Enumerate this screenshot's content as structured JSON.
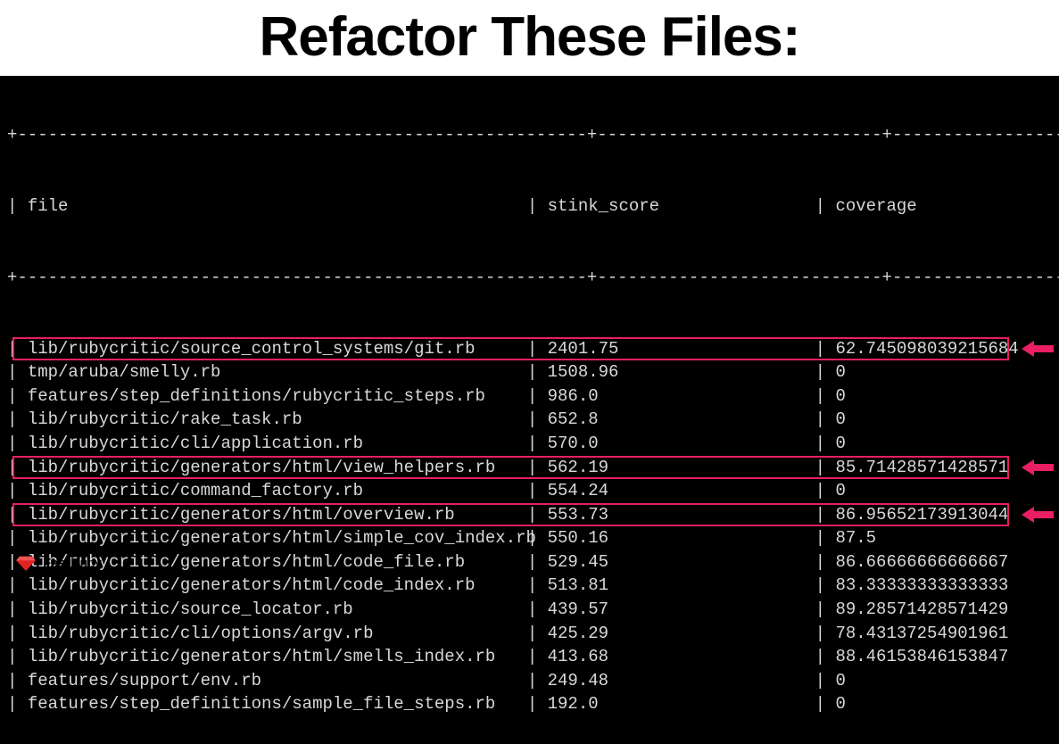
{
  "title": "Refactor These Files:",
  "footer": {
    "brand_bold": "Fast",
    "brand_rest": "Ruby"
  },
  "columns": {
    "file": "file",
    "stink": "stink_score",
    "coverage": "coverage"
  },
  "highlight_color": "#e91e63",
  "rows": [
    {
      "file": "lib/rubycritic/source_control_systems/git.rb",
      "stink": "2401.75",
      "cov": "62.745098039215684",
      "hl": true
    },
    {
      "file": "tmp/aruba/smelly.rb",
      "stink": "1508.96",
      "cov": "0",
      "hl": false
    },
    {
      "file": "features/step_definitions/rubycritic_steps.rb",
      "stink": "986.0",
      "cov": "0",
      "hl": false
    },
    {
      "file": "lib/rubycritic/rake_task.rb",
      "stink": "652.8",
      "cov": "0",
      "hl": false
    },
    {
      "file": "lib/rubycritic/cli/application.rb",
      "stink": "570.0",
      "cov": "0",
      "hl": false
    },
    {
      "file": "lib/rubycritic/generators/html/view_helpers.rb",
      "stink": "562.19",
      "cov": "85.71428571428571",
      "hl": true
    },
    {
      "file": "lib/rubycritic/command_factory.rb",
      "stink": "554.24",
      "cov": "0",
      "hl": false
    },
    {
      "file": "lib/rubycritic/generators/html/overview.rb",
      "stink": "553.73",
      "cov": "86.95652173913044",
      "hl": true
    },
    {
      "file": "lib/rubycritic/generators/html/simple_cov_index.rb",
      "stink": "550.16",
      "cov": "87.5",
      "hl": false
    },
    {
      "file": "lib/rubycritic/generators/html/code_file.rb",
      "stink": "529.45",
      "cov": "86.66666666666667",
      "hl": false
    },
    {
      "file": "lib/rubycritic/generators/html/code_index.rb",
      "stink": "513.81",
      "cov": "83.33333333333333",
      "hl": false
    },
    {
      "file": "lib/rubycritic/source_locator.rb",
      "stink": "439.57",
      "cov": "89.28571428571429",
      "hl": false
    },
    {
      "file": "lib/rubycritic/cli/options/argv.rb",
      "stink": "425.29",
      "cov": "78.43137254901961",
      "hl": false
    },
    {
      "file": "lib/rubycritic/generators/html/smells_index.rb",
      "stink": "413.68",
      "cov": "88.46153846153847",
      "hl": false
    },
    {
      "file": "features/support/env.rb",
      "stink": "249.48",
      "cov": "0",
      "hl": false
    },
    {
      "file": "features/step_definitions/sample_file_steps.rb",
      "stink": "192.0",
      "cov": "0",
      "hl": false
    }
  ]
}
